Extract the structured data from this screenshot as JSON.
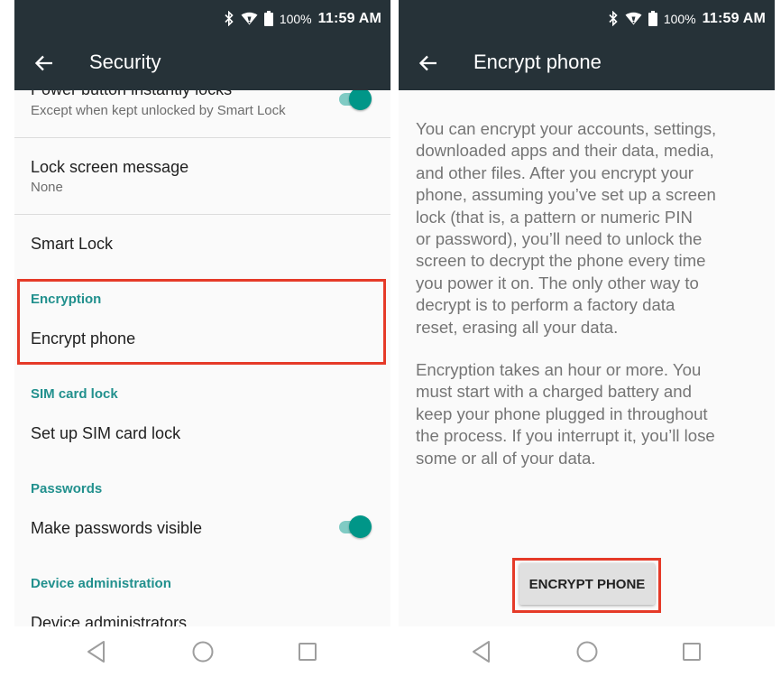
{
  "colors": {
    "appbar": "#263238",
    "accent": "#009688",
    "category": "#21908d",
    "highlight": "#e53a28"
  },
  "status_bar": {
    "battery": "100%",
    "time": "11:59 AM",
    "icons": [
      "bluetooth-icon",
      "wifi-icon",
      "battery-icon"
    ]
  },
  "security_screen": {
    "title": "Security",
    "items": [
      {
        "title": "Power button instantly locks",
        "summary": "Except when kept unlocked by Smart Lock",
        "toggle": true
      },
      {
        "title": "Lock screen message",
        "summary": "None"
      },
      {
        "title": "Smart Lock"
      }
    ],
    "categories": {
      "encryption": {
        "label": "Encryption",
        "item": "Encrypt phone"
      },
      "sim": {
        "label": "SIM card lock",
        "item": "Set up SIM card lock"
      },
      "passwords": {
        "label": "Passwords",
        "item": "Make passwords visible",
        "toggle": true
      },
      "device_admin": {
        "label": "Device administration",
        "item": "Device administrators"
      }
    }
  },
  "encrypt_screen": {
    "title": "Encrypt phone",
    "paragraph1_lines": [
      "You can encrypt your accounts, settings,",
      "downloaded apps and their data, media,",
      "and other files. After you encrypt your",
      "phone, assuming you’ve set up a screen",
      "lock (that is, a pattern or numeric PIN",
      "or password), you’ll need to unlock the",
      "screen to decrypt the phone every time",
      "you power it on. The only other way to",
      "decrypt is to perform a factory data",
      "reset, erasing all your data."
    ],
    "paragraph2_lines": [
      "Encryption takes an hour or more. You",
      "must start with a charged battery and",
      "keep your phone plugged in throughout",
      "the process. If you interrupt it, you’ll lose",
      "some or all of your data."
    ],
    "button_label": "ENCRYPT PHONE"
  },
  "nav_bar": {
    "buttons": [
      "back-icon",
      "home-icon",
      "recents-icon"
    ]
  }
}
